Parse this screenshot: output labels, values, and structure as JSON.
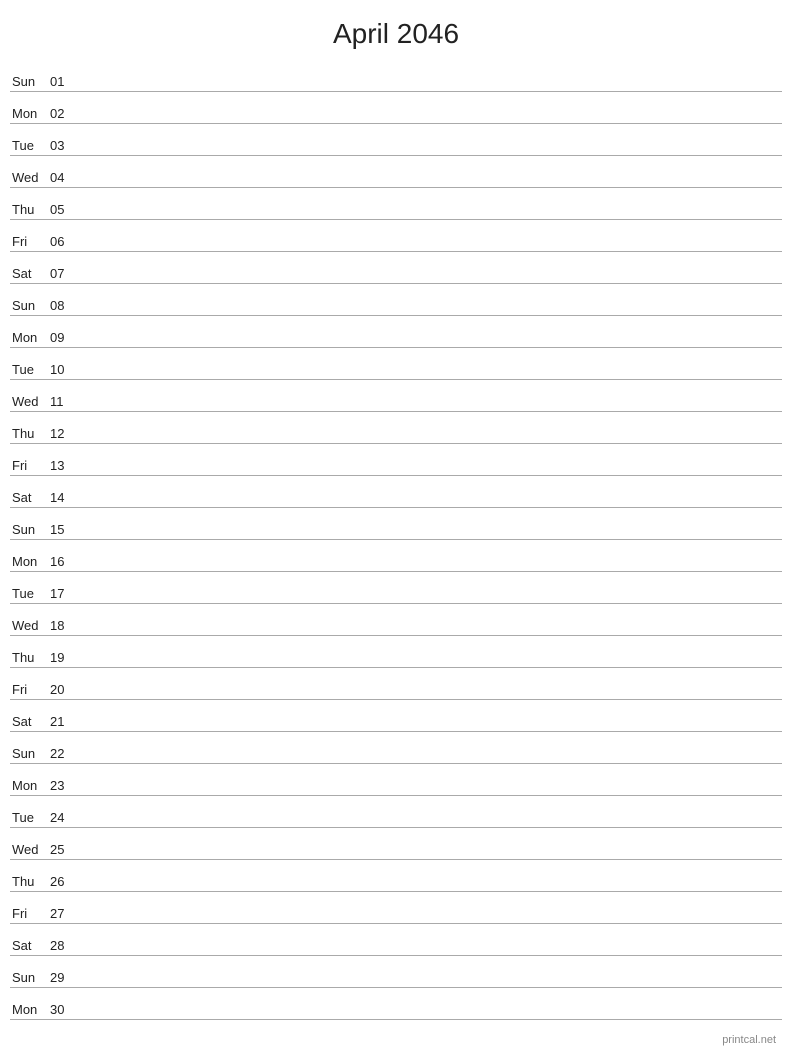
{
  "title": "April 2046",
  "days": [
    {
      "name": "Sun",
      "num": "01"
    },
    {
      "name": "Mon",
      "num": "02"
    },
    {
      "name": "Tue",
      "num": "03"
    },
    {
      "name": "Wed",
      "num": "04"
    },
    {
      "name": "Thu",
      "num": "05"
    },
    {
      "name": "Fri",
      "num": "06"
    },
    {
      "name": "Sat",
      "num": "07"
    },
    {
      "name": "Sun",
      "num": "08"
    },
    {
      "name": "Mon",
      "num": "09"
    },
    {
      "name": "Tue",
      "num": "10"
    },
    {
      "name": "Wed",
      "num": "11"
    },
    {
      "name": "Thu",
      "num": "12"
    },
    {
      "name": "Fri",
      "num": "13"
    },
    {
      "name": "Sat",
      "num": "14"
    },
    {
      "name": "Sun",
      "num": "15"
    },
    {
      "name": "Mon",
      "num": "16"
    },
    {
      "name": "Tue",
      "num": "17"
    },
    {
      "name": "Wed",
      "num": "18"
    },
    {
      "name": "Thu",
      "num": "19"
    },
    {
      "name": "Fri",
      "num": "20"
    },
    {
      "name": "Sat",
      "num": "21"
    },
    {
      "name": "Sun",
      "num": "22"
    },
    {
      "name": "Mon",
      "num": "23"
    },
    {
      "name": "Tue",
      "num": "24"
    },
    {
      "name": "Wed",
      "num": "25"
    },
    {
      "name": "Thu",
      "num": "26"
    },
    {
      "name": "Fri",
      "num": "27"
    },
    {
      "name": "Sat",
      "num": "28"
    },
    {
      "name": "Sun",
      "num": "29"
    },
    {
      "name": "Mon",
      "num": "30"
    }
  ],
  "footer": "printcal.net"
}
